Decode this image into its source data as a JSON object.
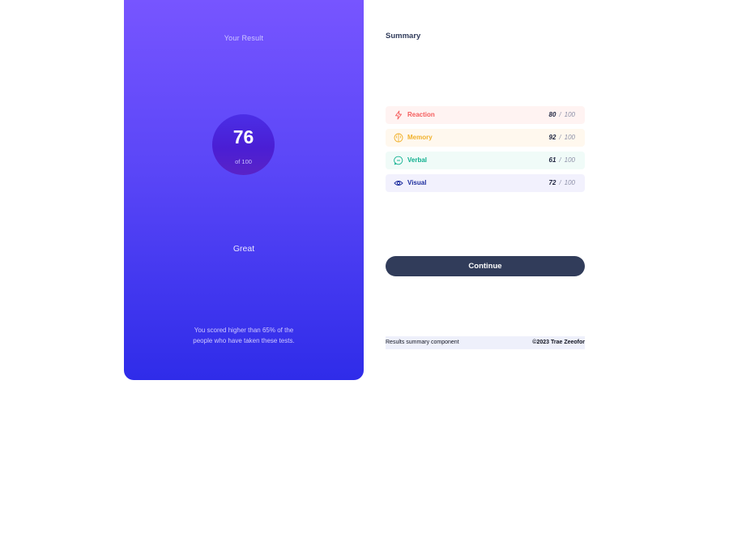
{
  "result": {
    "heading": "Your Result",
    "score": "76",
    "score_of": "of 100",
    "rating": "Great",
    "description": "You scored higher than 65% of the people who have taken these tests."
  },
  "summary": {
    "heading": "Summary",
    "items": [
      {
        "label": "Reaction",
        "score": "80",
        "max": "100",
        "icon": "lightning-icon",
        "color": "#f55d5d"
      },
      {
        "label": "Memory",
        "score": "92",
        "max": "100",
        "icon": "brain-icon",
        "color": "#f1b12c"
      },
      {
        "label": "Verbal",
        "score": "61",
        "max": "100",
        "icon": "speech-bubble-icon",
        "color": "#0fb08f"
      },
      {
        "label": "Visual",
        "score": "72",
        "max": "100",
        "icon": "eye-icon",
        "color": "#1d2d9e"
      }
    ],
    "continue_label": "Continue"
  },
  "footer": {
    "left": "Results summary component",
    "right": "©2023 Trae Zeeofor"
  },
  "colors": {
    "panel_top": "#7755ff",
    "panel_bottom": "#2f2ce9",
    "button": "#313c5a"
  }
}
